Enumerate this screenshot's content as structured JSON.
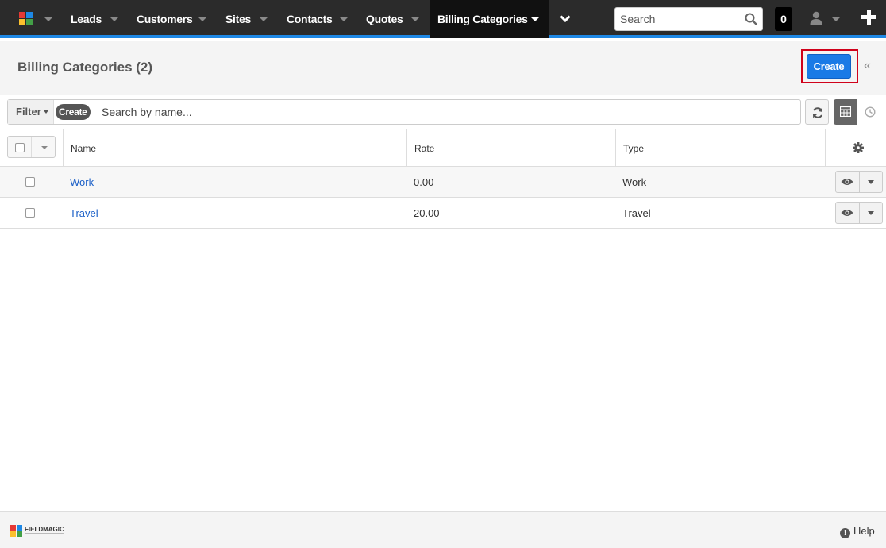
{
  "nav": {
    "items": [
      {
        "label": "Leads"
      },
      {
        "label": "Customers"
      },
      {
        "label": "Sites"
      },
      {
        "label": "Contacts"
      },
      {
        "label": "Quotes"
      },
      {
        "label": "Billing Categories"
      }
    ],
    "search_placeholder": "Search",
    "notification_count": "0",
    "accent_color": "#1e88e5"
  },
  "header": {
    "title": "Billing Categories (2)",
    "create_label": "Create"
  },
  "filter": {
    "filter_label": "Filter",
    "create_label": "Create",
    "search_placeholder": "Search by name..."
  },
  "table": {
    "columns": [
      "Name",
      "Rate",
      "Type"
    ],
    "rows": [
      {
        "name": "Work",
        "rate": "0.00",
        "type": "Work"
      },
      {
        "name": "Travel",
        "rate": "20.00",
        "type": "Travel"
      }
    ]
  },
  "footer": {
    "brand": "FIELDMAGIC",
    "help_label": "Help"
  }
}
